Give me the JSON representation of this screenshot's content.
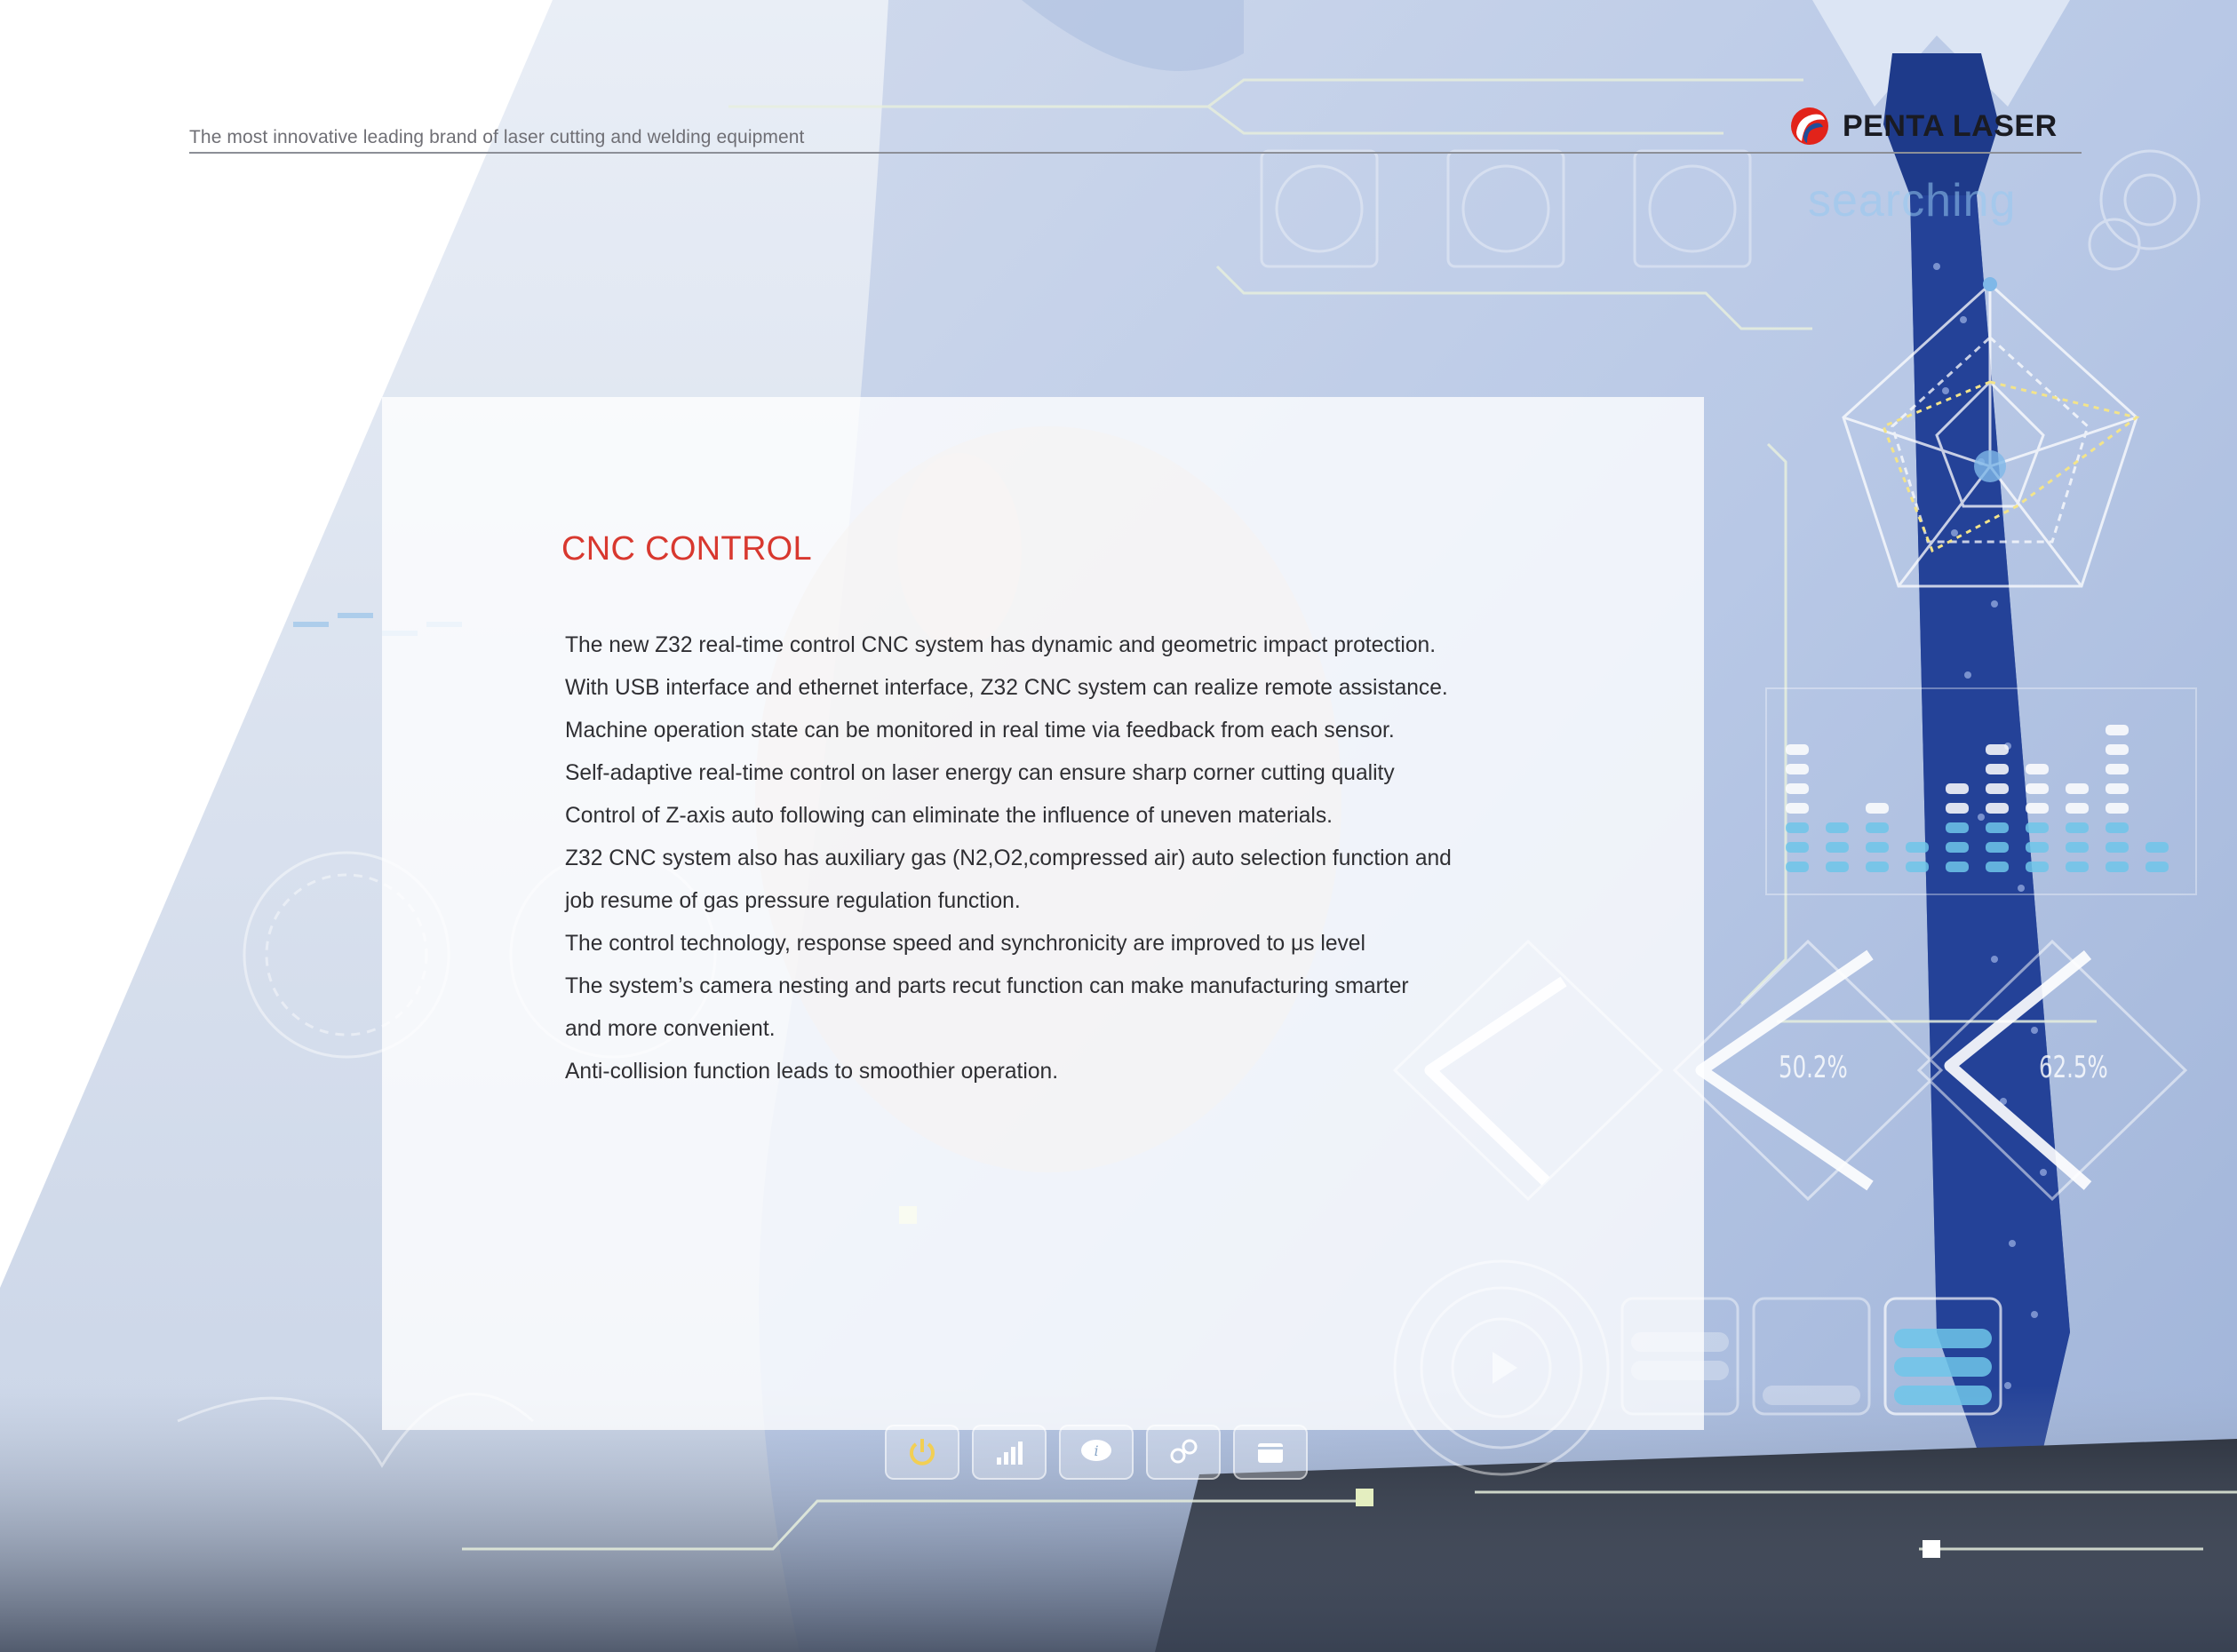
{
  "header": {
    "tagline": "The most innovative leading brand of laser cutting and welding equipment",
    "brand_name": "PENTA LASER"
  },
  "hud": {
    "searching": "searching",
    "gauges": [
      "50.2%",
      "62.5%"
    ]
  },
  "section": {
    "title": "CNC CONTROL",
    "lines": [
      "The new Z32 real-time control CNC system has dynamic and geometric impact protection.",
      "With USB interface and ethernet interface, Z32 CNC system can realize remote assistance.",
      "Machine operation state can be monitored in real time via feedback from each sensor.",
      "Self-adaptive real-time control on laser energy can ensure sharp corner cutting quality",
      "Control of Z-axis auto following can eliminate the influence of uneven materials.",
      "Z32 CNC system also has auxiliary gas (N2,O2,compressed air) auto selection function and",
      "job resume of gas pressure regulation function.",
      "The control technology, response speed and synchronicity are improved to μs level",
      "The system’s camera nesting and parts recut function can make manufacturing smarter",
      "and more convenient.",
      "Anti-collision function leads to smoothier operation."
    ]
  },
  "colors": {
    "accent": "#d8382f",
    "brand_red": "#e2231a",
    "brand_blue": "#1f4e9a",
    "text": "#2f2f33",
    "tie": "#1e3a8a",
    "hud_line": "#dfe9c8"
  }
}
